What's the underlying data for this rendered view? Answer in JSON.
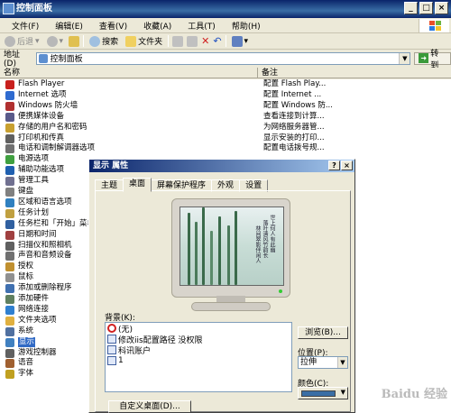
{
  "window": {
    "title": "控制面板",
    "min": "_",
    "max": "□",
    "close": "×"
  },
  "menu": [
    "文件(F)",
    "编辑(E)",
    "查看(V)",
    "收藏(A)",
    "工具(T)",
    "帮助(H)"
  ],
  "toolbar": {
    "back": "后退",
    "search": "搜索",
    "folders": "文件夹"
  },
  "address": {
    "label": "地址(D)",
    "value": "控制面板",
    "go": "转到"
  },
  "columns": {
    "name": "名称",
    "note": "备注"
  },
  "items": [
    {
      "name": "Flash Player",
      "note": "配置 Flash Play...",
      "icon_color": "#c8201e"
    },
    {
      "name": "Internet 选项",
      "note": "配置 Internet ...",
      "icon_color": "#2f6bd0"
    },
    {
      "name": "Windows 防火墙",
      "note": "配置 Windows 防...",
      "icon_color": "#b03030"
    },
    {
      "name": "便携媒体设备",
      "note": "查看连接到计算...",
      "icon_color": "#5a5a8a"
    },
    {
      "name": "存储的用户名和密码",
      "note": "为网络服务器管...",
      "icon_color": "#c8a030"
    },
    {
      "name": "打印机和传真",
      "note": "显示安装的打印...",
      "icon_color": "#606060"
    },
    {
      "name": "电话和调制解调器选项",
      "note": "配置电话拨号规...",
      "icon_color": "#707070"
    },
    {
      "name": "电源选项",
      "note": "",
      "icon_color": "#40a040"
    },
    {
      "name": "辅助功能选项",
      "note": "",
      "icon_color": "#2060b0"
    },
    {
      "name": "管理工具",
      "note": "",
      "icon_color": "#707090"
    },
    {
      "name": "键盘",
      "note": "",
      "icon_color": "#808080"
    },
    {
      "name": "区域和语言选项",
      "note": "",
      "icon_color": "#3080c0"
    },
    {
      "name": "任务计划",
      "note": "",
      "icon_color": "#c0a040"
    },
    {
      "name": "任务栏和「开始」菜单",
      "note": "",
      "icon_color": "#3060a0"
    },
    {
      "name": "日期和时间",
      "note": "",
      "icon_color": "#a04040"
    },
    {
      "name": "扫描仪和照相机",
      "note": "",
      "icon_color": "#606060"
    },
    {
      "name": "声音和音频设备",
      "note": "",
      "icon_color": "#707070"
    },
    {
      "name": "授权",
      "note": "",
      "icon_color": "#c09030"
    },
    {
      "name": "鼠标",
      "note": "",
      "icon_color": "#909090"
    },
    {
      "name": "添加或删除程序",
      "note": "",
      "icon_color": "#4070b0"
    },
    {
      "name": "添加硬件",
      "note": "",
      "icon_color": "#608060"
    },
    {
      "name": "网络连接",
      "note": "",
      "icon_color": "#3080d0"
    },
    {
      "name": "文件夹选项",
      "note": "",
      "icon_color": "#e0b040"
    },
    {
      "name": "系统",
      "note": "",
      "icon_color": "#5070a0"
    },
    {
      "name": "显示",
      "note": "",
      "icon_color": "#4080c0",
      "selected": true
    },
    {
      "name": "游戏控制器",
      "note": "",
      "icon_color": "#606060"
    },
    {
      "name": "语音",
      "note": "",
      "icon_color": "#a06030"
    },
    {
      "name": "字体",
      "note": "",
      "icon_color": "#c0a020"
    }
  ],
  "dialog": {
    "title": "显示 属性",
    "help": "?",
    "close": "×",
    "tabs": [
      "主题",
      "桌面",
      "屏幕保护程序",
      "外观",
      "设置"
    ],
    "active_tab": 1,
    "poem_lines": [
      "世上何人有此幽",
      "落叶清风竹韵长",
      "林间翠影伴闲人"
    ],
    "bg_label": "背景(K):",
    "bg_list": [
      "(无)",
      "修改iis配置路径 没权限",
      "科讯账户",
      "1"
    ],
    "browse": "浏览(B)...",
    "pos_label": "位置(P):",
    "pos_value": "拉伸",
    "color_label": "颜色(C):",
    "color_value": "#3a6ea5",
    "custom": "自定义桌面(D)..."
  },
  "watermark": "Baidu 经验"
}
